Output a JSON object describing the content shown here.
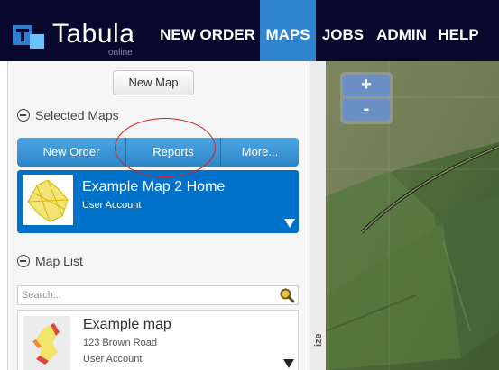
{
  "brand": {
    "name": "Tabula",
    "sub": "online"
  },
  "nav": {
    "new_order": "NEW ORDER",
    "maps": "MAPS",
    "jobs": "JOBS",
    "admin": "ADMIN",
    "help": "HELP",
    "active": "MAPS"
  },
  "sidebar": {
    "new_map_label": "New Map",
    "selected_maps_heading": "Selected Maps",
    "tabs": {
      "new_order": "New Order",
      "reports": "Reports",
      "more": "More..."
    },
    "selected_map": {
      "title": "Example Map 2 Home",
      "account": "User Account"
    },
    "map_list_heading": "Map List",
    "search": {
      "placeholder": "Search...",
      "value": ""
    },
    "list": [
      {
        "title": "Example map",
        "address": "123 Brown Road",
        "account": "User Account"
      }
    ],
    "resize_label": "ize"
  },
  "map": {
    "zoom_in": "+",
    "zoom_out": "-"
  },
  "colors": {
    "nav_bg": "#08082e",
    "accent_blue": "#2e84cf",
    "selected_card": "#0071c8",
    "highlight_ring": "#d92020"
  }
}
